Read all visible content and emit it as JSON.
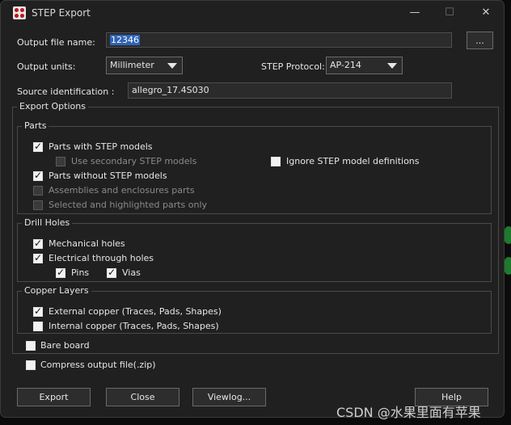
{
  "window": {
    "title": "STEP Export",
    "minimize_glyph": "—",
    "maximize_glyph": "☐",
    "close_glyph": "✕"
  },
  "file": {
    "label": "Output file name:",
    "value": "12346",
    "browse_label": "..."
  },
  "units": {
    "label": "Output units:",
    "value": "Millimeter"
  },
  "protocol": {
    "label": "STEP Protocol:",
    "value": "AP-214"
  },
  "source": {
    "label": "Source identification :",
    "value": "allegro_17.4S030"
  },
  "export_options": {
    "title": "Export Options"
  },
  "parts": {
    "title": "Parts",
    "with_models": {
      "label": "Parts with STEP models",
      "checked": true
    },
    "secondary": {
      "label": "Use secondary STEP models",
      "checked": false
    },
    "ignore_defs": {
      "label": "Ignore STEP model definitions",
      "checked": false
    },
    "without_models": {
      "label": "Parts without STEP models",
      "checked": true
    },
    "assemblies": {
      "label": "Assemblies and enclosures parts",
      "checked": false
    },
    "selected_only": {
      "label": "Selected and highlighted parts only",
      "checked": false
    }
  },
  "drill": {
    "title": "Drill Holes",
    "mechanical": {
      "label": "Mechanical holes",
      "checked": true
    },
    "electrical": {
      "label": "Electrical through holes",
      "checked": true
    },
    "pins": {
      "label": "Pins",
      "checked": true
    },
    "vias": {
      "label": "Vias",
      "checked": true
    }
  },
  "copper": {
    "title": "Copper Layers",
    "external": {
      "label": "External copper (Traces, Pads, Shapes)",
      "checked": true
    },
    "internal": {
      "label": "Internal copper (Traces, Pads, Shapes)",
      "checked": false
    }
  },
  "bare_board": {
    "label": "Bare board",
    "checked": false
  },
  "compress": {
    "label": "Compress output file(.zip)",
    "checked": false
  },
  "buttons": {
    "export": "Export",
    "close": "Close",
    "viewlog": "Viewlog...",
    "help": "Help"
  },
  "watermark": "CSDN @水果里面有苹果",
  "colors": {
    "dialog_bg": "#202020",
    "selection": "#2f63b8",
    "app_icon_red": "#c0141c"
  }
}
